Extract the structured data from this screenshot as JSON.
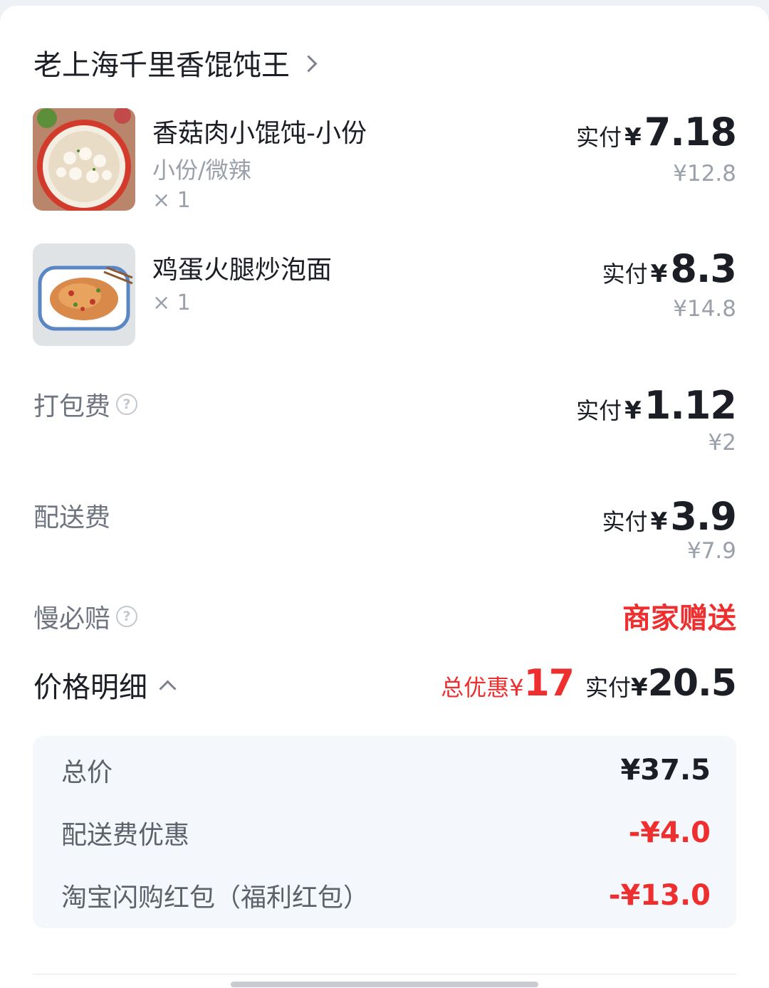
{
  "shop": {
    "name": "老上海千里香馄饨王"
  },
  "items": [
    {
      "name": "香菇肉小馄饨-小份",
      "spec": "小份/微辣",
      "qty": "× 1",
      "pay_label": "实付",
      "currency": "¥",
      "pay": "7.18",
      "original": "¥12.8"
    },
    {
      "name": "鸡蛋火腿炒泡面",
      "qty": "× 1",
      "pay_label": "实付",
      "currency": "¥",
      "pay": "8.3",
      "original": "¥14.8"
    }
  ],
  "packing": {
    "label": "打包费",
    "pay_label": "实付",
    "currency": "¥",
    "pay": "1.12",
    "original": "¥2"
  },
  "delivery": {
    "label": "配送费",
    "pay_label": "实付",
    "currency": "¥",
    "pay": "3.9",
    "original": "¥7.9"
  },
  "late_comp": {
    "label": "慢必赔",
    "value": "商家赠送"
  },
  "price_detail": {
    "label": "价格明细",
    "discount_label": "总优惠¥",
    "discount_value": "17",
    "pay_label": "实付",
    "currency": "¥",
    "pay_value": "20.5"
  },
  "breakdown": [
    {
      "label": "总价",
      "value": "¥37.5"
    },
    {
      "label": "配送费优惠",
      "value": "-¥4.0"
    },
    {
      "label": "淘宝闪购红包（福利红包）",
      "value": "-¥13.0"
    }
  ],
  "colors": {
    "accent_red": "#ee2f2f",
    "muted": "#9aa1ab",
    "text": "#1b1e24",
    "panel": "#f4f7fb"
  },
  "icons": [
    "chevron-right-icon",
    "help-circle-icon",
    "chevron-up-icon"
  ]
}
